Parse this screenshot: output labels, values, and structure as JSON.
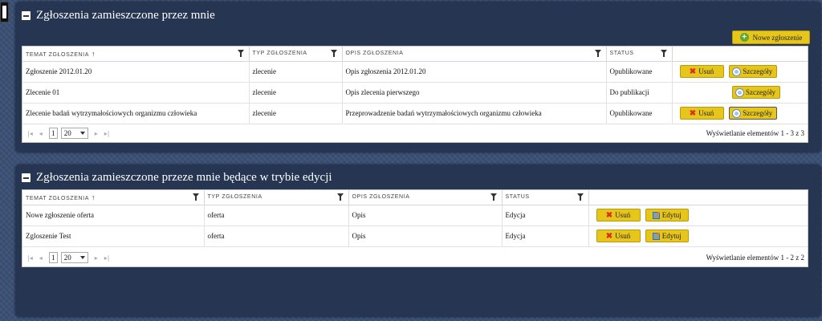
{
  "panel1": {
    "title": "Zgłoszenia zamieszczone przez mnie",
    "new_button_label": "Nowe zgłoszenie",
    "columns": [
      "TEMAT ZGŁOSZENIA",
      "TYP ZGŁOSZENIA",
      "OPIS ZGŁOSZENIA",
      "STATUS"
    ],
    "rows": [
      {
        "topic": "Zgłoszenie 2012.01.20",
        "type": "zlecenie",
        "description": "Opis zgłoszenia 2012.01.20",
        "status": "Opublikowane",
        "delete": "Usuń",
        "details": "Szczegóły"
      },
      {
        "topic": "Zlecenie 01",
        "type": "zlecenie",
        "description": "Opis zlecenia pierwszego",
        "status": "Do publikacji",
        "delete": "Usuń",
        "details": "Szczegóły"
      },
      {
        "topic": "Zlecenie badań wytrzymałościowych organizmu człowieka",
        "type": "zlecenie",
        "description": "Przeprowadzenie badań wytrzymałościowych organizmu człowieka",
        "status": "Opublikowane",
        "delete": "Usuń",
        "details": "Szczegóły"
      }
    ],
    "pager": {
      "page": "1",
      "page_size": "20",
      "info": "Wyświetlanie elementów 1 - 3 z 3"
    }
  },
  "panel2": {
    "title": "Zgłoszenia zamieszczone przeze mnie będące w trybie edycji",
    "columns": [
      "TEMAT ZGŁOSZENIA",
      "TYP ZGŁOSZENIA",
      "OPIS ZGŁOSZENIA",
      "STATUS"
    ],
    "rows": [
      {
        "topic": "Nowe zgłoszenie oferta",
        "type": "oferta",
        "description": "Opis",
        "status": "Edycja",
        "delete": "Usuń",
        "edit": "Edytuj"
      },
      {
        "topic": "Zgloszenie Test",
        "type": "oferta",
        "description": "Opis",
        "status": "Edycja",
        "delete": "Usuń",
        "edit": "Edytuj"
      }
    ],
    "pager": {
      "page": "1",
      "page_size": "20",
      "info": "Wyświetlanie elementów 1 - 2 z 2"
    }
  },
  "icons": {
    "sort": "↑",
    "first": "|◂",
    "prev": "◂",
    "next": "▸",
    "last": "▸|",
    "delete": "✖",
    "add": "+"
  },
  "colors": {
    "background": "#3a5075",
    "panel": "#253552",
    "button": "#e6c61a"
  }
}
